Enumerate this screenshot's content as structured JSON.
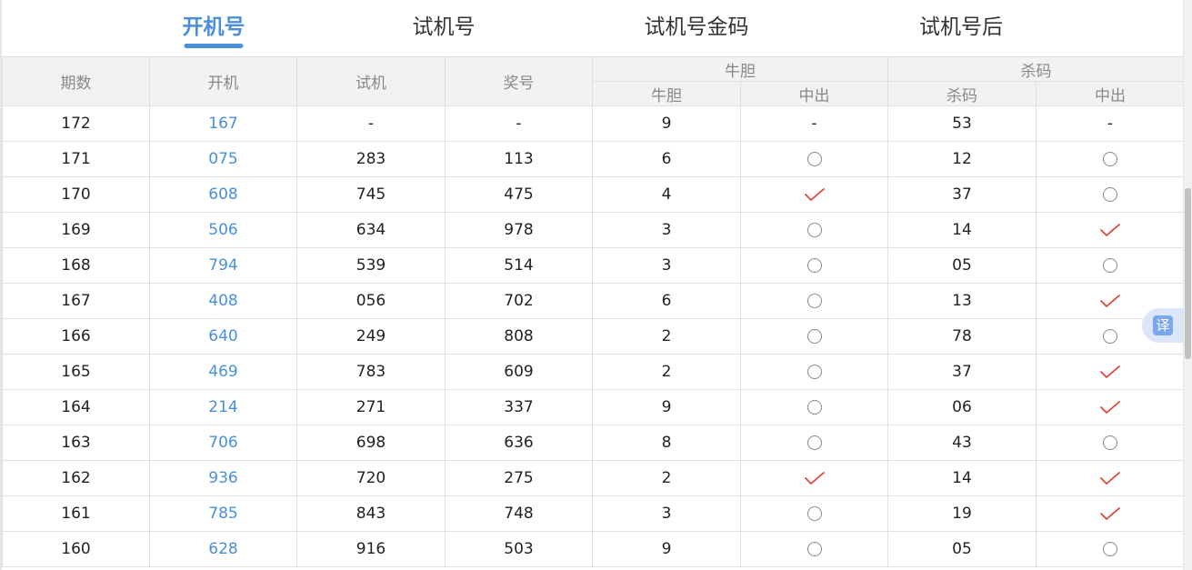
{
  "tabs": [
    {
      "label": "开机号",
      "active": true
    },
    {
      "label": "试机号",
      "active": false
    },
    {
      "label": "试机号金码",
      "active": false
    },
    {
      "label": "试机号后",
      "active": false
    }
  ],
  "table": {
    "headers": {
      "qishu": "期数",
      "kaiji": "开机",
      "shiji": "试机",
      "jianghao": "奖号",
      "niudan_group": "牛胆",
      "niudan": "牛胆",
      "niudan_hit": "中出",
      "shama_group": "杀码",
      "shama": "杀码",
      "shama_hit": "中出"
    },
    "rows": [
      {
        "qishu": "172",
        "kaiji": "167",
        "shiji": "-",
        "jianghao": "-",
        "niudan": "9",
        "niudan_hit": "-",
        "shama": "53",
        "shama_hit": "-"
      },
      {
        "qishu": "171",
        "kaiji": "075",
        "shiji": "283",
        "jianghao": "113",
        "niudan": "6",
        "niudan_hit": "circle",
        "shama": "12",
        "shama_hit": "circle"
      },
      {
        "qishu": "170",
        "kaiji": "608",
        "shiji": "745",
        "jianghao": "475",
        "niudan": "4",
        "niudan_hit": "check",
        "shama": "37",
        "shama_hit": "circle"
      },
      {
        "qishu": "169",
        "kaiji": "506",
        "shiji": "634",
        "jianghao": "978",
        "niudan": "3",
        "niudan_hit": "circle",
        "shama": "14",
        "shama_hit": "check"
      },
      {
        "qishu": "168",
        "kaiji": "794",
        "shiji": "539",
        "jianghao": "514",
        "niudan": "3",
        "niudan_hit": "circle",
        "shama": "05",
        "shama_hit": "circle"
      },
      {
        "qishu": "167",
        "kaiji": "408",
        "shiji": "056",
        "jianghao": "702",
        "niudan": "6",
        "niudan_hit": "circle",
        "shama": "13",
        "shama_hit": "check"
      },
      {
        "qishu": "166",
        "kaiji": "640",
        "shiji": "249",
        "jianghao": "808",
        "niudan": "2",
        "niudan_hit": "circle",
        "shama": "78",
        "shama_hit": "circle"
      },
      {
        "qishu": "165",
        "kaiji": "469",
        "shiji": "783",
        "jianghao": "609",
        "niudan": "2",
        "niudan_hit": "circle",
        "shama": "37",
        "shama_hit": "check"
      },
      {
        "qishu": "164",
        "kaiji": "214",
        "shiji": "271",
        "jianghao": "337",
        "niudan": "9",
        "niudan_hit": "circle",
        "shama": "06",
        "shama_hit": "check"
      },
      {
        "qishu": "163",
        "kaiji": "706",
        "shiji": "698",
        "jianghao": "636",
        "niudan": "8",
        "niudan_hit": "circle",
        "shama": "43",
        "shama_hit": "circle"
      },
      {
        "qishu": "162",
        "kaiji": "936",
        "shiji": "720",
        "jianghao": "275",
        "niudan": "2",
        "niudan_hit": "check",
        "shama": "14",
        "shama_hit": "check"
      },
      {
        "qishu": "161",
        "kaiji": "785",
        "shiji": "843",
        "jianghao": "748",
        "niudan": "3",
        "niudan_hit": "circle",
        "shama": "19",
        "shama_hit": "check"
      },
      {
        "qishu": "160",
        "kaiji": "628",
        "shiji": "916",
        "jianghao": "503",
        "niudan": "9",
        "niudan_hit": "circle",
        "shama": "05",
        "shama_hit": "circle"
      }
    ]
  },
  "translate_button": {
    "icon": "translate-icon",
    "glyph": "译"
  },
  "colors": {
    "accent": "#4a8fd9",
    "check": "#e0463a",
    "circle": "#888888",
    "header_bg": "#f2f2f2"
  }
}
